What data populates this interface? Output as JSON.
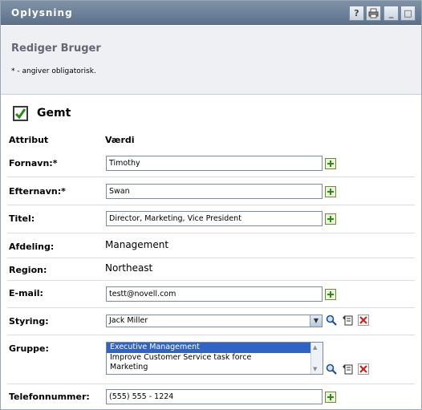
{
  "window": {
    "title": "Oplysning",
    "buttons": {
      "help": "?",
      "print": "⎙",
      "minimize": "_",
      "maximize": "□"
    }
  },
  "header": {
    "title": "Rediger Bruger",
    "note": "* - angiver obligatorisk."
  },
  "status": {
    "label": "Gemt"
  },
  "columns": {
    "attribute": "Attribut",
    "value": "Værdi"
  },
  "fields": {
    "firstname": {
      "label": "Fornavn:*",
      "value": "Timothy"
    },
    "lastname": {
      "label": "Efternavn:*",
      "value": "Swan"
    },
    "title": {
      "label": "Titel:",
      "value": "Director, Marketing, Vice President"
    },
    "department": {
      "label": "Afdeling:",
      "value": "Management"
    },
    "region": {
      "label": "Region:",
      "value": "Northeast"
    },
    "email": {
      "label": "E-mail:",
      "value": "testt@novell.com"
    },
    "manager": {
      "label": "Styring:",
      "value": "Jack Miller"
    },
    "group": {
      "label": "Gruppe:",
      "options": [
        "Executive Management",
        "Improve Customer Service task force",
        "Marketing"
      ],
      "selected": "Executive Management"
    },
    "phone": {
      "label": "Telefonnummer:",
      "value": "(555) 555 - 1224"
    }
  }
}
